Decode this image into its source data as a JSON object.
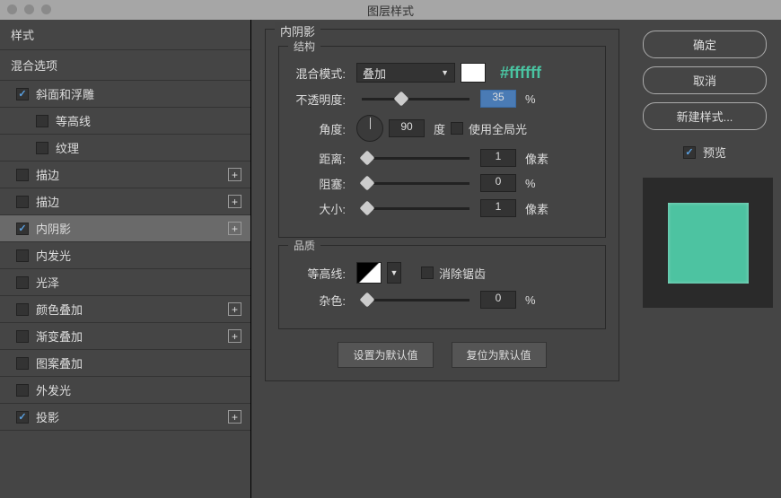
{
  "window": {
    "title": "图层样式"
  },
  "left": {
    "section1": "样式",
    "section2": "混合选项",
    "items": [
      {
        "label": "斜面和浮雕",
        "checked": true,
        "plus": false,
        "indent": false
      },
      {
        "label": "等高线",
        "checked": false,
        "plus": false,
        "indent": true
      },
      {
        "label": "纹理",
        "checked": false,
        "plus": false,
        "indent": true
      },
      {
        "label": "描边",
        "checked": false,
        "plus": true,
        "indent": false
      },
      {
        "label": "描边",
        "checked": false,
        "plus": true,
        "indent": false
      },
      {
        "label": "内阴影",
        "checked": true,
        "plus": true,
        "indent": false,
        "selected": true
      },
      {
        "label": "内发光",
        "checked": false,
        "plus": false,
        "indent": false
      },
      {
        "label": "光泽",
        "checked": false,
        "plus": false,
        "indent": false
      },
      {
        "label": "颜色叠加",
        "checked": false,
        "plus": true,
        "indent": false
      },
      {
        "label": "渐变叠加",
        "checked": false,
        "plus": true,
        "indent": false
      },
      {
        "label": "图案叠加",
        "checked": false,
        "plus": false,
        "indent": false
      },
      {
        "label": "外发光",
        "checked": false,
        "plus": false,
        "indent": false
      },
      {
        "label": "投影",
        "checked": true,
        "plus": true,
        "indent": false
      }
    ]
  },
  "panel": {
    "title": "内阴影",
    "structure": {
      "title": "结构",
      "blend_label": "混合模式:",
      "blend_value": "叠加",
      "hex": "#ffffff",
      "opacity_label": "不透明度:",
      "opacity_value": "35",
      "opacity_unit": "%",
      "angle_label": "角度:",
      "angle_value": "90",
      "angle_unit": "度",
      "global_label": "使用全局光",
      "distance_label": "距离:",
      "distance_value": "1",
      "distance_unit": "像素",
      "choke_label": "阻塞:",
      "choke_value": "0",
      "choke_unit": "%",
      "size_label": "大小:",
      "size_value": "1",
      "size_unit": "像素"
    },
    "quality": {
      "title": "品质",
      "contour_label": "等高线:",
      "aa_label": "消除锯齿",
      "noise_label": "杂色:",
      "noise_value": "0",
      "noise_unit": "%"
    },
    "btn_default": "设置为默认值",
    "btn_reset": "复位为默认值"
  },
  "right": {
    "ok": "确定",
    "cancel": "取消",
    "new_style": "新建样式...",
    "preview_label": "预览"
  }
}
